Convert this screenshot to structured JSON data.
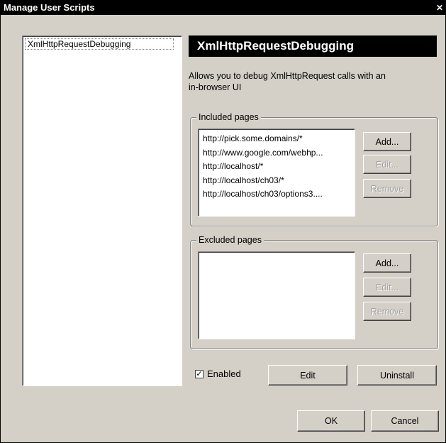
{
  "window": {
    "title": "Manage User Scripts",
    "close_glyph": "✕"
  },
  "script_list": {
    "items": [
      "XmlHttpRequestDebugging"
    ]
  },
  "script": {
    "name": "XmlHttpRequestDebugging",
    "description_line1": "Allows you to debug XmlHttpRequest calls with an",
    "description_line2": "in-browser UI"
  },
  "included": {
    "label": "Included pages",
    "pages": [
      "http://pick.some.domains/*",
      "http://www.google.com/webhp...",
      "http://localhost/*",
      "http://localhost/ch03/*",
      "http://localhost/ch03/options3...."
    ],
    "add_label": "Add...",
    "edit_label": "Edit...",
    "remove_label": "Remove"
  },
  "excluded": {
    "label": "Excluded pages",
    "pages": [],
    "add_label": "Add...",
    "edit_label": "Edit...",
    "remove_label": "Remove"
  },
  "footer": {
    "enabled_checked": true,
    "check_glyph": "✓",
    "enabled_label": "Enabled",
    "edit_label": "Edit",
    "uninstall_label": "Uninstall",
    "ok_label": "OK",
    "cancel_label": "Cancel"
  },
  "colors": {
    "dialog_bg": "#d4d0c8",
    "title_bg": "#000000",
    "title_text": "#ffffff",
    "disabled_text": "#a0a0a0"
  }
}
